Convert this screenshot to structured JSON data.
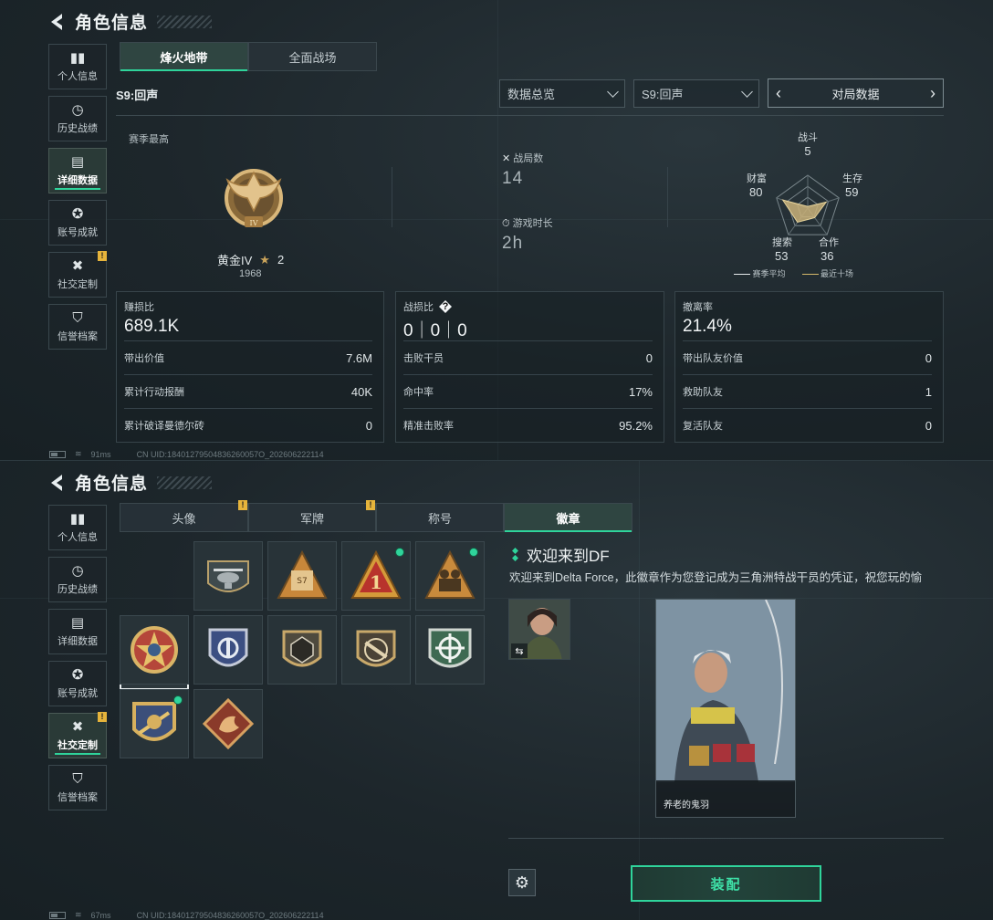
{
  "top": {
    "title": "角色信息",
    "sidebar": [
      {
        "label": "个人信息",
        "icon": "bar-chart-icon"
      },
      {
        "label": "历史战绩",
        "icon": "clock-icon"
      },
      {
        "label": "详细数据",
        "icon": "folder-icon"
      },
      {
        "label": "账号成就",
        "icon": "medal-icon"
      },
      {
        "label": "社交定制",
        "icon": "tools-icon"
      },
      {
        "label": "信誉档案",
        "icon": "shield-icon"
      }
    ],
    "tabs": [
      "烽火地带",
      "全面战场"
    ],
    "season": "S9:回声",
    "select_overview": "数据总览",
    "select_season": "S9:回声",
    "pager_label": "对局数据",
    "season_best_label": "赛季最高",
    "rank_name": "黄金IV",
    "rank_stars": "2",
    "rank_score": "1968",
    "matches_label": "战局数",
    "matches_value": "14",
    "playtime_label": "游戏时长",
    "playtime_value": "2h",
    "radar": {
      "combat_label": "战斗",
      "combat": "5",
      "survival_label": "生存",
      "survival": "59",
      "cooperation_label": "合作",
      "cooperation": "36",
      "search_label": "搜索",
      "search": "53",
      "wealth_label": "财富",
      "wealth": "80",
      "legend_avg": "赛季平均",
      "legend_recent": "最近十场"
    },
    "card1": {
      "caption": "赚损比",
      "value": "689.1K",
      "rows": [
        [
          "带出价值",
          "7.6M"
        ],
        [
          "累计行动报酬",
          "40K"
        ],
        [
          "累计破译曼德尔砖",
          "0"
        ]
      ]
    },
    "card2": {
      "caption": "战损比",
      "value": "0｜0｜0",
      "rows": [
        [
          "击败干员",
          "0"
        ],
        [
          "命中率",
          "17%"
        ],
        [
          "精准击败率",
          "95.2%"
        ]
      ]
    },
    "card3": {
      "caption": "撤离率",
      "value": "21.4%",
      "rows": [
        [
          "带出队友价值",
          "0"
        ],
        [
          "救助队友",
          "1"
        ],
        [
          "复活队友",
          "0"
        ]
      ]
    },
    "status_ping": "91ms",
    "uid": "CN UID:18401279504836260057O_202606222114"
  },
  "bottom": {
    "title": "角色信息",
    "tabs": [
      "头像",
      "军牌",
      "称号",
      "徽章"
    ],
    "detail_title": "欢迎来到DF",
    "detail_desc": "欢迎来到Delta Force，此徽章作为您登记成为三角洲特战干员的凭证，祝您玩的愉",
    "card_name": "养老的鬼羽",
    "equip_label": "装配",
    "status_ping": "67ms",
    "uid": "CN UID:18401279504836260057O_202606222114"
  },
  "colors": {
    "accent": "#2fd49b",
    "warning": "#e6b43b",
    "gold": "#c9a35a"
  }
}
